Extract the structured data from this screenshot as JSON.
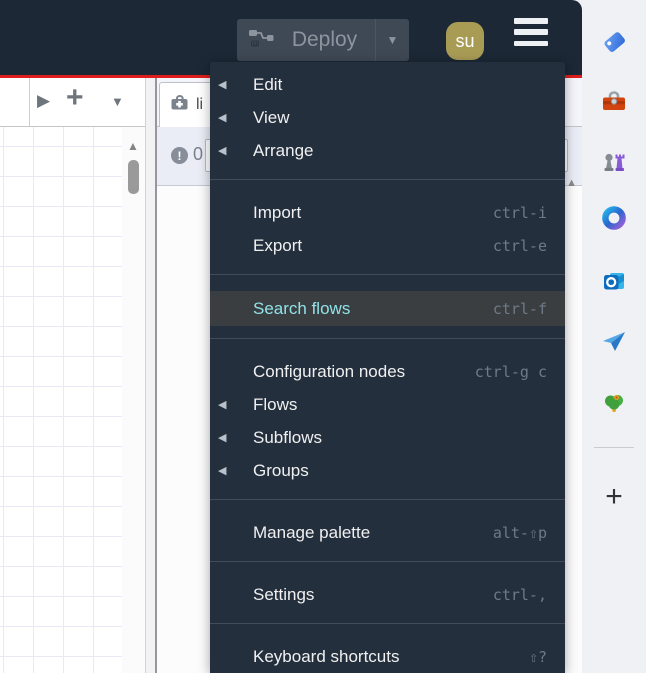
{
  "header": {
    "deploy_label": "Deploy",
    "deploy_caret": "▼",
    "avatar_text": "su"
  },
  "menu": {
    "submenu_arrow": "◀",
    "groups": [
      {
        "items": [
          {
            "label": "Edit",
            "submenu": true
          },
          {
            "label": "View",
            "submenu": true
          },
          {
            "label": "Arrange",
            "submenu": true
          }
        ]
      },
      {
        "items": [
          {
            "label": "Import",
            "shortcut": "ctrl-i"
          },
          {
            "label": "Export",
            "shortcut": "ctrl-e"
          }
        ]
      },
      {
        "items": [
          {
            "label": "Search flows",
            "shortcut": "ctrl-f",
            "highlighted": true
          }
        ]
      },
      {
        "items": [
          {
            "label": "Configuration nodes",
            "shortcut": "ctrl-g c"
          },
          {
            "label": "Flows",
            "submenu": true
          },
          {
            "label": "Subflows",
            "submenu": true
          },
          {
            "label": "Groups",
            "submenu": true
          }
        ]
      },
      {
        "items": [
          {
            "label": "Manage palette",
            "shortcut": "alt-⇧p"
          }
        ]
      },
      {
        "items": [
          {
            "label": "Settings",
            "shortcut": "ctrl-,"
          }
        ]
      },
      {
        "items": [
          {
            "label": "Keyboard shortcuts",
            "shortcut": "⇧?"
          }
        ]
      }
    ]
  },
  "canvas": {
    "toolbar": {
      "scroll_right": "▶",
      "add_flow": "+",
      "flow_list": "▼"
    },
    "scroll_up": "▲"
  },
  "side_panel": {
    "tab_label": "li",
    "tab_icon": "medkit-icon",
    "error_icon": "!",
    "error_count": "0",
    "scroll_up": "▲"
  },
  "browser_sidebar": {
    "icons": [
      {
        "name": "shopping-tag-icon"
      },
      {
        "name": "toolbox-icon"
      },
      {
        "name": "games-chess-icon"
      },
      {
        "name": "copilot-icon"
      },
      {
        "name": "outlook-icon"
      },
      {
        "name": "paper-plane-icon"
      },
      {
        "name": "tree-icon"
      }
    ],
    "add_label": "+"
  },
  "colors": {
    "header_bg": "#1c2836",
    "menu_bg": "#242f3d",
    "accent_red": "#df1d1d",
    "highlight_row_bg": "#3a3e41",
    "highlight_text": "#90e2e8",
    "avatar_bg": "#a89c55",
    "deploy_btn_bg": "#3f4955"
  }
}
